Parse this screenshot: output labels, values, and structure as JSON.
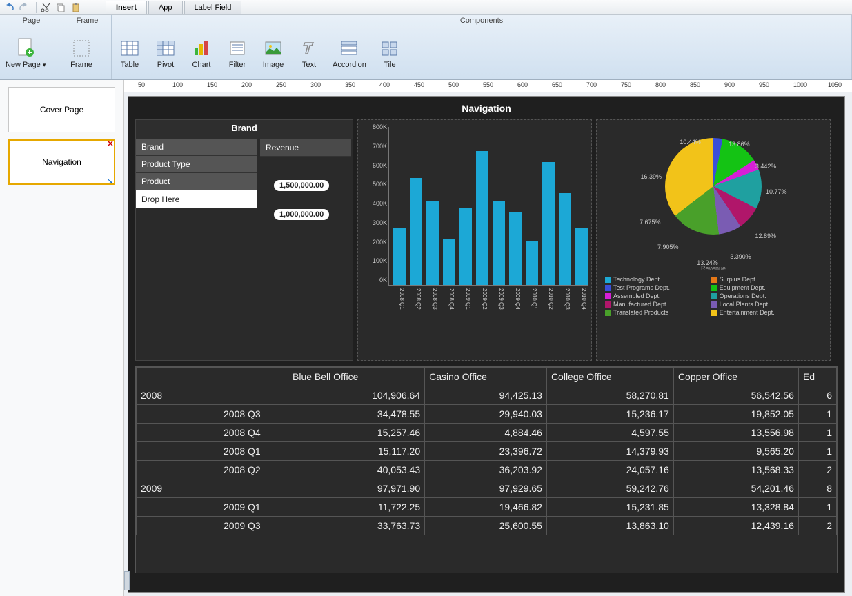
{
  "tabs": {
    "insert": "Insert",
    "app": "App",
    "label_field": "Label Field"
  },
  "ribbon": {
    "page_group": "Page",
    "frame_group": "Frame",
    "components_group": "Components",
    "new_page": "New Page",
    "frame": "Frame",
    "table": "Table",
    "pivot": "Pivot",
    "chart": "Chart",
    "filter": "Filter",
    "image": "Image",
    "text": "Text",
    "accordion": "Accordion",
    "tile": "Tile"
  },
  "thumbs": {
    "cover": "Cover Page",
    "navigation": "Navigation"
  },
  "dashboard": {
    "title": "Navigation",
    "brand": {
      "title": "Brand",
      "dims": [
        "Brand",
        "Product Type",
        "Product"
      ],
      "drop": "Drop Here",
      "metric_head": "Revenue",
      "pill1": "1,500,000.00",
      "pill2": "1,000,000.00"
    },
    "pie_caption": "Revenue",
    "table": {
      "cols": [
        "Blue Bell Office",
        "Casino Office",
        "College Office",
        "Copper Office",
        "Ed"
      ],
      "rows": [
        {
          "h": "2008",
          "sub": "",
          "v": [
            "104,906.64",
            "94,425.13",
            "58,270.81",
            "56,542.56",
            "6"
          ]
        },
        {
          "h": "",
          "sub": "2008 Q3",
          "v": [
            "34,478.55",
            "29,940.03",
            "15,236.17",
            "19,852.05",
            "1"
          ]
        },
        {
          "h": "",
          "sub": "2008 Q4",
          "v": [
            "15,257.46",
            "4,884.46",
            "4,597.55",
            "13,556.98",
            "1"
          ]
        },
        {
          "h": "",
          "sub": "2008 Q1",
          "v": [
            "15,117.20",
            "23,396.72",
            "14,379.93",
            "9,565.20",
            "1"
          ]
        },
        {
          "h": "",
          "sub": "2008 Q2",
          "v": [
            "40,053.43",
            "36,203.92",
            "24,057.16",
            "13,568.33",
            "2"
          ]
        },
        {
          "h": "2009",
          "sub": "",
          "v": [
            "97,971.90",
            "97,929.65",
            "59,242.76",
            "54,201.46",
            "8"
          ]
        },
        {
          "h": "",
          "sub": "2009 Q1",
          "v": [
            "11,722.25",
            "19,466.82",
            "15,231.85",
            "13,328.84",
            "1"
          ]
        },
        {
          "h": "",
          "sub": "2009 Q3",
          "v": [
            "33,763.73",
            "25,600.55",
            "13,863.10",
            "12,439.16",
            "2"
          ]
        }
      ]
    }
  },
  "chart_data": [
    {
      "type": "bar",
      "title": "",
      "xlabel": "",
      "ylabel": "",
      "ylim": [
        0,
        800000
      ],
      "y_ticks": [
        "0K",
        "100K",
        "200K",
        "300K",
        "400K",
        "500K",
        "600K",
        "700K",
        "800K"
      ],
      "categories": [
        "2008 Q1",
        "2008 Q2",
        "2008 Q3",
        "2008 Q4",
        "2009 Q1",
        "2009 Q2",
        "2009 Q3",
        "2009 Q4",
        "2010 Q1",
        "2010 Q2",
        "2010 Q3",
        "2010 Q4"
      ],
      "values": [
        300000,
        560000,
        440000,
        240000,
        400000,
        700000,
        440000,
        380000,
        230000,
        640000,
        480000,
        300000
      ]
    },
    {
      "type": "pie",
      "title": "Revenue",
      "series": [
        {
          "name": "Technology Dept.",
          "value": 13.86,
          "color": "#1da9d4"
        },
        {
          "name": "Surplus Dept.",
          "value": 3.442,
          "color": "#e67817"
        },
        {
          "name": "Test Programs Dept.",
          "value": 10.77,
          "color": "#3a4fd9"
        },
        {
          "name": "Equipment Dept.",
          "value": 12.89,
          "color": "#14c314"
        },
        {
          "name": "Assembled Dept.",
          "value": 3.39,
          "color": "#d61fd6"
        },
        {
          "name": "Operations Dept.",
          "value": 13.24,
          "color": "#1fa0a0"
        },
        {
          "name": "Manufactured Dept.",
          "value": 7.905,
          "color": "#b0166a"
        },
        {
          "name": "Local Plants Dept.",
          "value": 7.675,
          "color": "#7a5cb3"
        },
        {
          "name": "Translated Products",
          "value": 16.39,
          "color": "#49a02a"
        },
        {
          "name": "Entertainment Dept.",
          "value": 10.44,
          "color": "#f2c319"
        }
      ]
    }
  ]
}
